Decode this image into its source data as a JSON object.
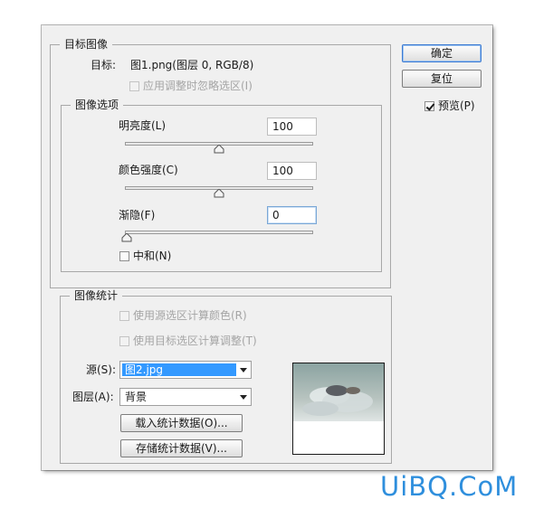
{
  "dialog": {
    "target_image": {
      "legend": "目标图像",
      "target_label": "目标:",
      "target_value": "图1.png(图层 0, RGB/8)",
      "ignore_selection_label": "应用调整时忽略选区(I)"
    },
    "image_options": {
      "legend": "图像选项",
      "luminance": {
        "label": "明亮度(L)",
        "value": "100",
        "slider_fraction": 0.5
      },
      "color_intensity": {
        "label": "颜色强度(C)",
        "value": "100",
        "slider_fraction": 0.5
      },
      "fade": {
        "label": "渐隐(F)",
        "value": "0",
        "slider_fraction": 0.0
      },
      "neutralize": {
        "label": "中和(N)",
        "checked": false
      }
    },
    "image_statistics": {
      "legend": "图像统计",
      "use_source_selection_color": "使用源选区计算颜色(R)",
      "use_target_selection_adjust": "使用目标选区计算调整(T)",
      "source": {
        "label": "源(S):",
        "value": "图2.jpg"
      },
      "layer": {
        "label": "图层(A):",
        "value": "背景"
      },
      "load_button": "载入统计数据(O)...",
      "save_button": "存储统计数据(V)..."
    },
    "buttons": {
      "ok": "确定",
      "reset": "复位"
    },
    "preview": {
      "label": "预览(P)",
      "checked": true
    }
  },
  "watermark": "UiBQ.CoM",
  "colors": {
    "dialog_bg": "#f0f0f0",
    "selection_blue": "#3399ff",
    "default_button_border": "#3d7bd2",
    "watermark": "#2f8fdd"
  }
}
